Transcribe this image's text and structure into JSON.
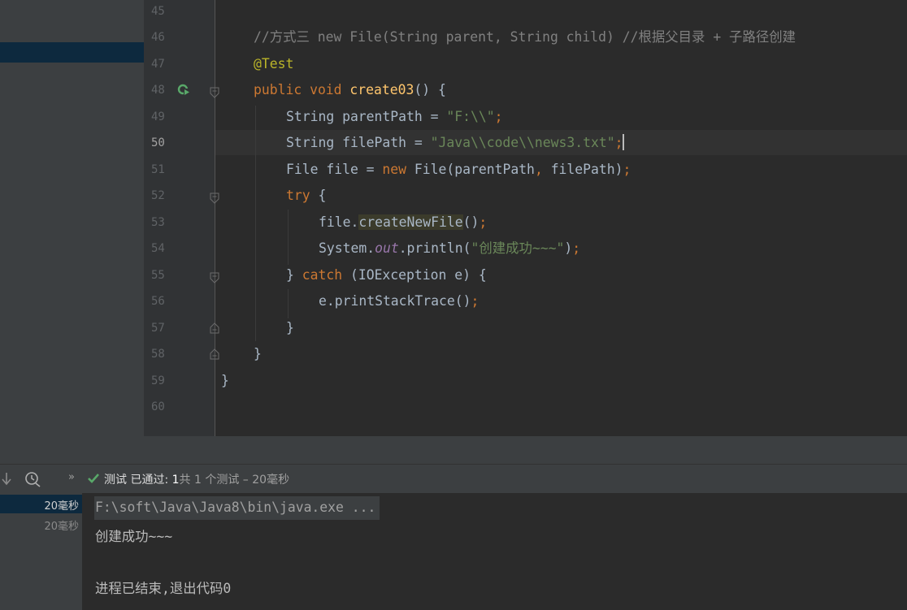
{
  "gutter": {
    "line_numbers": [
      "45",
      "46",
      "47",
      "48",
      "49",
      "50",
      "51",
      "52",
      "53",
      "54",
      "55",
      "56",
      "57",
      "58",
      "59",
      "60"
    ]
  },
  "code": {
    "l46_comment": "//方式三 new File(String parent, String child) //根据父目录 + 子路径创建",
    "l47_annotation": "@Test",
    "l48_kw": "public void ",
    "l48_method": "create03",
    "l48_rest": "() {",
    "l49_type": "String parentPath = ",
    "l49_str": "\"F:\\\\\"",
    "l49_semi": ";",
    "l50_type": "String filePath = ",
    "l50_str": "\"Java\\\\code\\\\news3.txt\"",
    "l50_semi": ";",
    "l51_a": "File file = ",
    "l51_new": "new ",
    "l51_b": "File(parentPath",
    "l51_comma": ", ",
    "l51_c": "filePath)",
    "l51_semi": ";",
    "l52_kw": "try",
    "l52_rest": " {",
    "l53_obj": "file.",
    "l53_call": "createNewFile",
    "l53_rest": "()",
    "l53_semi": ";",
    "l54_a": "System.",
    "l54_out": "out",
    "l54_b": ".println(",
    "l54_str": "\"创建成功~~~\"",
    "l54_c": ")",
    "l54_semi": ";",
    "l55_a": "} ",
    "l55_kw": "catch",
    "l55_b": " (IOException e) {",
    "l56_a": "e.printStackTrace()",
    "l56_semi": ";",
    "l57": "}",
    "l58": "}",
    "l59": "}"
  },
  "run": {
    "status_prefix": "测试 已通过: ",
    "status_count": "1",
    "status_suffix": "共 1 个测试 – 20毫秒",
    "tree_items": [
      "20毫秒",
      "20毫秒"
    ],
    "console_lines": [
      "F:\\soft\\Java\\Java8\\bin\\java.exe ...",
      "创建成功~~~",
      "",
      "进程已结束,退出代码0"
    ]
  },
  "colors": {
    "keyword": "#cc7832",
    "string": "#6a8759",
    "annotation": "#bbb529",
    "comment": "#808080",
    "method": "#ffc66d",
    "pass": "#59a869"
  }
}
